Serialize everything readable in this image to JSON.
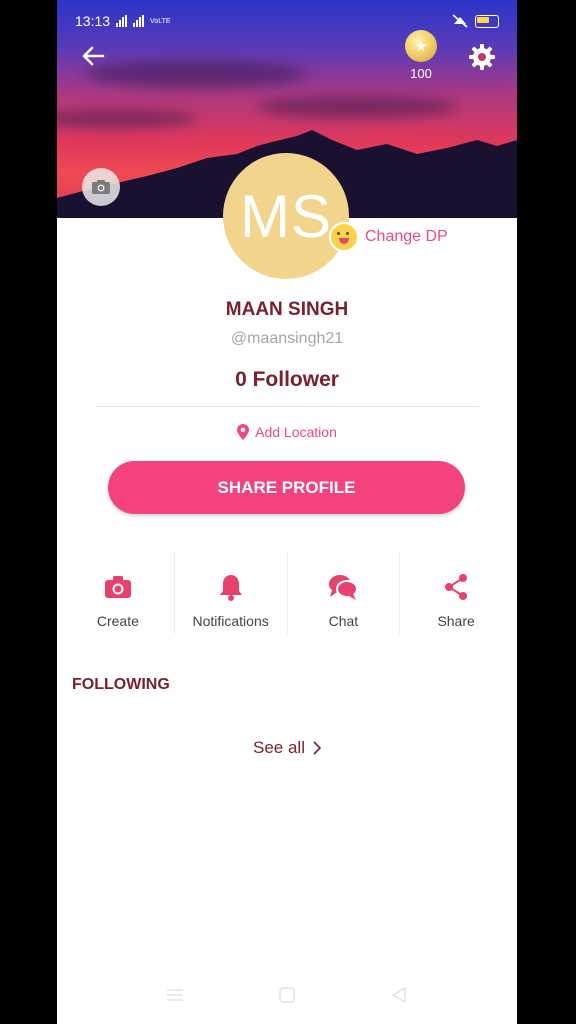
{
  "status_bar": {
    "time": "13:13",
    "network": "VoLTE"
  },
  "header": {
    "coins": "100"
  },
  "profile": {
    "avatar_initials": "MS",
    "change_dp_label": "Change DP",
    "name": "MAAN SINGH",
    "handle": "@maansingh21",
    "followers_text": "0 Follower",
    "location_label": "Add Location",
    "share_profile_label": "SHARE PROFILE"
  },
  "actions": [
    {
      "label": "Create",
      "icon": "camera-icon"
    },
    {
      "label": "Notifications",
      "icon": "bell-icon"
    },
    {
      "label": "Chat",
      "icon": "chat-icon"
    },
    {
      "label": "Share",
      "icon": "share-icon"
    }
  ],
  "following": {
    "title": "FOLLOWING",
    "see_all_label": "See all"
  },
  "colors": {
    "accent": "#f4437c",
    "text_dark": "#7a1f2c",
    "avatar_bg": "#f3d48d"
  }
}
